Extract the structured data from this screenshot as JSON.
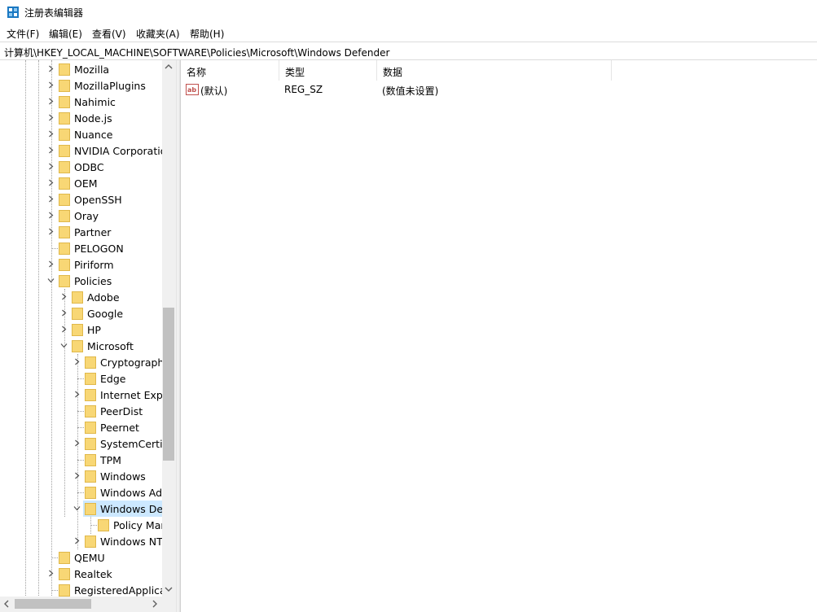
{
  "window": {
    "title": "注册表编辑器"
  },
  "menu": [
    "文件(F)",
    "编辑(E)",
    "查看(V)",
    "收藏夹(A)",
    "帮助(H)"
  ],
  "address": "计算机\\HKEY_LOCAL_MACHINE\\SOFTWARE\\Policies\\Microsoft\\Windows Defender",
  "tree": [
    {
      "label": "Mozilla",
      "level": 0,
      "arrow": "right"
    },
    {
      "label": "MozillaPlugins",
      "level": 0,
      "arrow": "right"
    },
    {
      "label": "Nahimic",
      "level": 0,
      "arrow": "right"
    },
    {
      "label": "Node.js",
      "level": 0,
      "arrow": "right"
    },
    {
      "label": "Nuance",
      "level": 0,
      "arrow": "right"
    },
    {
      "label": "NVIDIA Corporatio",
      "level": 0,
      "arrow": "right"
    },
    {
      "label": "ODBC",
      "level": 0,
      "arrow": "right"
    },
    {
      "label": "OEM",
      "level": 0,
      "arrow": "right"
    },
    {
      "label": "OpenSSH",
      "level": 0,
      "arrow": "right"
    },
    {
      "label": "Oray",
      "level": 0,
      "arrow": "right"
    },
    {
      "label": "Partner",
      "level": 0,
      "arrow": "right"
    },
    {
      "label": "PELOGON",
      "level": 0,
      "arrow": "none"
    },
    {
      "label": "Piriform",
      "level": 0,
      "arrow": "right"
    },
    {
      "label": "Policies",
      "level": 0,
      "arrow": "down"
    },
    {
      "label": "Adobe",
      "level": 1,
      "arrow": "right"
    },
    {
      "label": "Google",
      "level": 1,
      "arrow": "right"
    },
    {
      "label": "HP",
      "level": 1,
      "arrow": "right"
    },
    {
      "label": "Microsoft",
      "level": 1,
      "arrow": "down"
    },
    {
      "label": "Cryptography",
      "level": 2,
      "arrow": "right"
    },
    {
      "label": "Edge",
      "level": 2,
      "arrow": "none"
    },
    {
      "label": "Internet Explo",
      "level": 2,
      "arrow": "right"
    },
    {
      "label": "PeerDist",
      "level": 2,
      "arrow": "none"
    },
    {
      "label": "Peernet",
      "level": 2,
      "arrow": "none"
    },
    {
      "label": "SystemCertifi",
      "level": 2,
      "arrow": "right"
    },
    {
      "label": "TPM",
      "level": 2,
      "arrow": "none"
    },
    {
      "label": "Windows",
      "level": 2,
      "arrow": "right"
    },
    {
      "label": "Windows Adv",
      "level": 2,
      "arrow": "none"
    },
    {
      "label": "Windows Def",
      "level": 2,
      "arrow": "down",
      "selected": true
    },
    {
      "label": "Policy Mar",
      "level": 3,
      "arrow": "none"
    },
    {
      "label": "Windows NT",
      "level": 2,
      "arrow": "right"
    },
    {
      "label": "QEMU",
      "level": 0,
      "arrow": "none"
    },
    {
      "label": "Realtek",
      "level": 0,
      "arrow": "right"
    },
    {
      "label": "RegisteredApplicat",
      "level": 0,
      "arrow": "none"
    }
  ],
  "list": {
    "columns": [
      "名称",
      "类型",
      "数据"
    ],
    "rows": [
      {
        "name": "(默认)",
        "type": "REG_SZ",
        "data": "(数值未设置)"
      }
    ]
  },
  "colors": {
    "selection": "#cce8ff",
    "folder": "#f8d775",
    "folder_edge": "#e0b84a"
  },
  "icons": {
    "app": "registry-icon",
    "folder": "folder-icon",
    "value": "string-value-icon"
  }
}
